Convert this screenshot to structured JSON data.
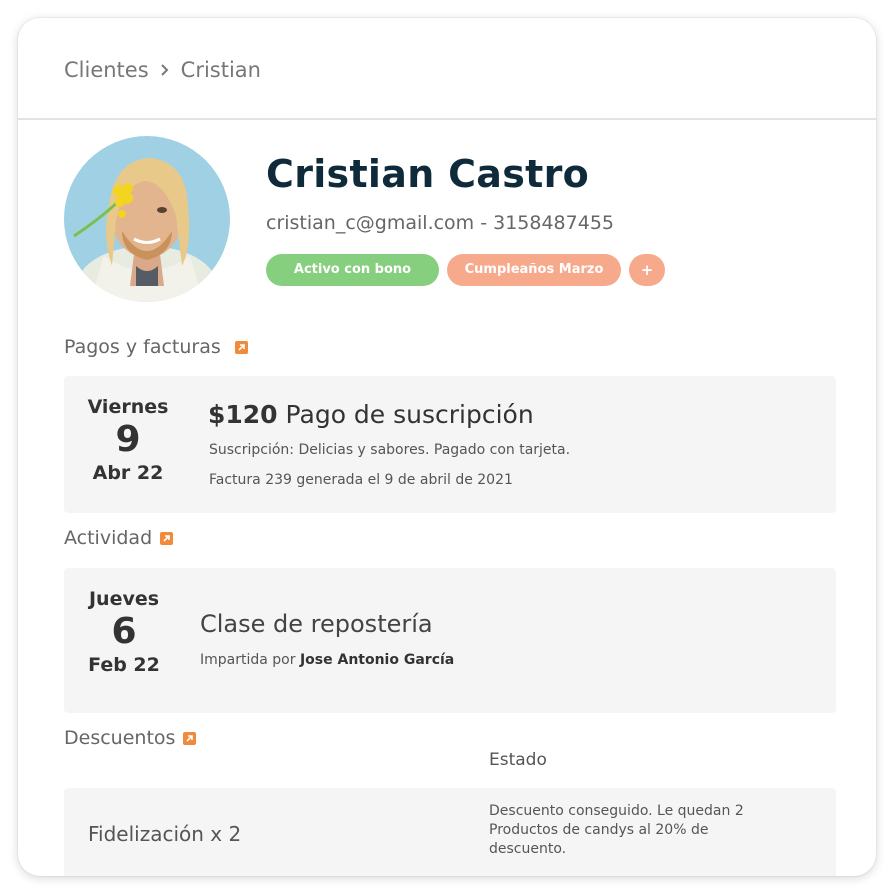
{
  "breadcrumb": {
    "parent": "Clientes",
    "current": "Cristian"
  },
  "profile": {
    "name": "Cristian Castro",
    "contact": "cristian_c@gmail.com - 3158487455",
    "tags": [
      "Activo con bono",
      "Cumpleaños Marzo",
      "+"
    ]
  },
  "payments": {
    "title": "Pagos y facturas",
    "item": {
      "day": "Viernes",
      "date": "9",
      "month": "Abr 22",
      "amount": "$120",
      "title": "Pago de suscripción",
      "line1": "Suscripción: Delicias y sabores. Pagado con tarjeta.",
      "line2": "Factura 239 generada el 9 de abril de 2021"
    }
  },
  "activity": {
    "title": "Actividad",
    "item": {
      "day": "Jueves",
      "date": "6",
      "month": "Feb 22",
      "title": "Clase de repostería",
      "by_prefix": "Impartida por",
      "by_name": "Jose Antonio García"
    }
  },
  "discounts": {
    "title": "Descuentos",
    "column_header": "Estado",
    "item": {
      "name": "Fidelización x 2",
      "state": "Descuento conseguido. Le quedan 2 Productos  de candys  al 20% de descuento."
    }
  },
  "colors": {
    "accent_orange": "#f28a3c",
    "tag_green": "#86cf7e",
    "tag_orange": "#f7a98b",
    "name_color": "#0f2a3a"
  }
}
